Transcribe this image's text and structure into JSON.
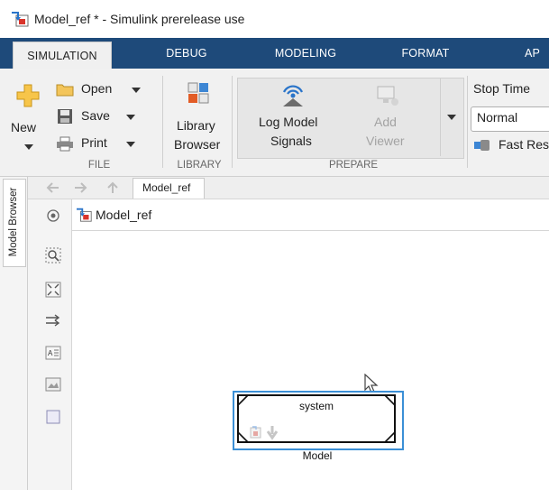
{
  "window": {
    "title": "Model_ref * - Simulink prerelease use"
  },
  "ribbon": {
    "tabs": [
      "SIMULATION",
      "DEBUG",
      "MODELING",
      "FORMAT",
      "AP"
    ],
    "active_tab": "SIMULATION",
    "file": {
      "section_label": "FILE",
      "new_label": "New",
      "open_label": "Open",
      "save_label": "Save",
      "print_label": "Print"
    },
    "library": {
      "section_label": "LIBRARY",
      "library_line1": "Library",
      "library_line2": "Browser"
    },
    "prepare": {
      "section_label": "PREPARE",
      "log_line1": "Log Model",
      "log_line2": "Signals",
      "add_line1": "Add",
      "add_line2": "Viewer"
    },
    "simulate": {
      "stop_time_label": "Stop Time",
      "mode_value": "Normal",
      "fast_restart_label": "Fast Res"
    }
  },
  "browser": {
    "model_browser_label": "Model Browser",
    "breadcrumb": "Model_ref",
    "address": "Model_ref"
  },
  "canvas": {
    "block": {
      "content_label": "system",
      "name": "Model"
    }
  },
  "colors": {
    "tabbar": "#1e4a7a",
    "selection": "#3b8fd6"
  }
}
